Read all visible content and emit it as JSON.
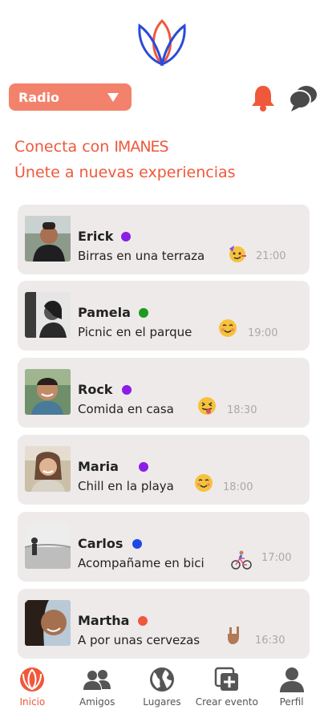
{
  "header": {
    "radio_label": "Radio",
    "headline_prefix": "Conecta con",
    "brand": "IMANES",
    "subheadline": "Únete a nuevas experiencias"
  },
  "colors": {
    "accent": "#f0583b",
    "button": "#f3826c",
    "card": "#eeeaea"
  },
  "feed": [
    {
      "name": "Erick",
      "status_color": "#8a1ee6",
      "activity": "Birras en una terraza",
      "emoji": "party-face-icon",
      "time": "21:00"
    },
    {
      "name": "Pamela",
      "status_color": "#1e9a1e",
      "activity": "Picnic en el parque",
      "emoji": "smiling-face-icon",
      "time": "19:00"
    },
    {
      "name": "Rock",
      "status_color": "#8a1ee6",
      "activity": "Comida en casa",
      "emoji": "tongue-out-face-icon",
      "time": "18:30"
    },
    {
      "name": "Maria",
      "status_color": "#8a1ee6",
      "activity": "Chill en la playa",
      "emoji": "smiling-face-icon",
      "time": "18:00"
    },
    {
      "name": "Carlos",
      "status_color": "#1e48e6",
      "activity": "Acompañame en bici",
      "emoji": "cyclist-icon",
      "time": "17:00"
    },
    {
      "name": "Martha",
      "status_color": "#f0583b",
      "activity": "A por unas cervezas",
      "emoji": "rock-hand-icon",
      "time": "16:30"
    }
  ],
  "nav": [
    {
      "label": "Inicio",
      "icon": "home-logo-icon",
      "active": true
    },
    {
      "label": "Amigos",
      "icon": "friends-icon",
      "active": false
    },
    {
      "label": "Lugares",
      "icon": "globe-icon",
      "active": false
    },
    {
      "label": "Crear evento",
      "icon": "create-event-icon",
      "active": false
    },
    {
      "label": "Perfil",
      "icon": "profile-icon",
      "active": false
    }
  ]
}
